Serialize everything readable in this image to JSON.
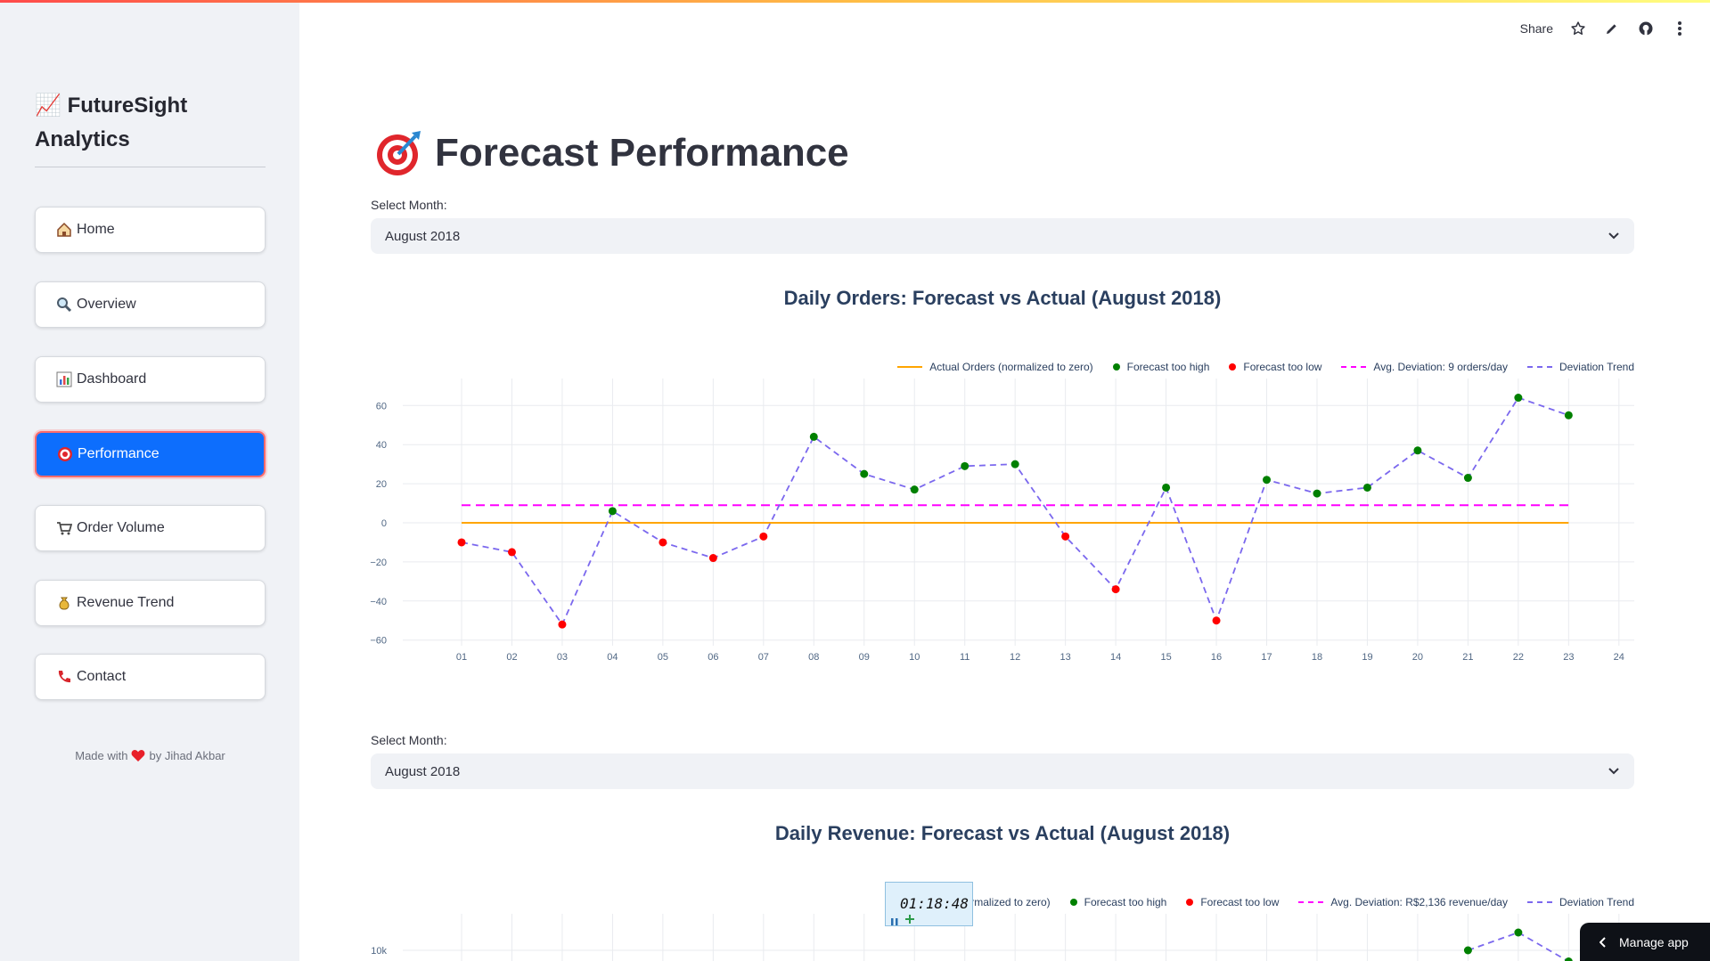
{
  "app": {
    "brand_emoji": "📈",
    "brand": "FutureSight Analytics"
  },
  "header": {
    "share_label": "Share",
    "icons": [
      "star-icon",
      "pencil-icon",
      "github-icon",
      "more-vertical-icon"
    ]
  },
  "sidebar": {
    "items": [
      {
        "label": "Home",
        "icon": "house-icon",
        "emoji": "🏠",
        "active": false
      },
      {
        "label": "Overview",
        "icon": "magnifier-icon",
        "emoji": "🔍",
        "active": false
      },
      {
        "label": "Dashboard",
        "icon": "bar-chart-icon",
        "emoji": "📊",
        "active": false
      },
      {
        "label": "Performance",
        "icon": "target-icon",
        "emoji": "🎯",
        "active": true
      },
      {
        "label": "Order Volume",
        "icon": "cart-icon",
        "emoji": "🛒",
        "active": false
      },
      {
        "label": "Revenue Trend",
        "icon": "money-bag-icon",
        "emoji": "💰",
        "active": false
      },
      {
        "label": "Contact",
        "icon": "phone-icon",
        "emoji": "📞",
        "active": false
      }
    ],
    "footer_pre": "Made with",
    "footer_post": "by Jihad Akbar"
  },
  "page": {
    "title_emoji": "🎯",
    "title": "Forecast Performance"
  },
  "orders_section": {
    "select_label": "Select Month:",
    "select_value": "August 2018",
    "chart_title": "Daily Orders: Forecast vs Actual (August 2018)"
  },
  "revenue_section": {
    "select_label": "Select Month:",
    "select_value": "August 2018",
    "chart_title": "Daily Revenue: Forecast vs Actual (August 2018)"
  },
  "colors": {
    "actual": "#ffa500",
    "too_high": "#008000",
    "too_low": "#ff0000",
    "avg": "#ff00ff",
    "trend": "#7b68ee",
    "active_nav": "#0d6efd"
  },
  "chart_data": [
    {
      "type": "line",
      "title": "Daily Orders: Forecast vs Actual (August 2018)",
      "x": [
        "01",
        "02",
        "03",
        "04",
        "05",
        "06",
        "07",
        "08",
        "09",
        "10",
        "11",
        "12",
        "13",
        "14",
        "15",
        "16",
        "17",
        "18",
        "19",
        "20",
        "21",
        "22",
        "23"
      ],
      "x_ticks": [
        "01",
        "02",
        "03",
        "04",
        "05",
        "06",
        "07",
        "08",
        "09",
        "10",
        "11",
        "12",
        "13",
        "14",
        "15",
        "16",
        "17",
        "18",
        "19",
        "20",
        "21",
        "22",
        "23",
        "24"
      ],
      "ylim": [
        -62,
        68
      ],
      "y_ticks": [
        60,
        40,
        20,
        0,
        -20,
        -40,
        -60
      ],
      "legend": [
        "Actual Orders (normalized to zero)",
        "Forecast too high",
        "Forecast too low",
        "Avg. Deviation: 9 orders/day",
        "Deviation Trend"
      ],
      "legend_position": "top-right",
      "series": [
        {
          "name": "Actual Orders (normalized to zero)",
          "values": [
            0,
            0,
            0,
            0,
            0,
            0,
            0,
            0,
            0,
            0,
            0,
            0,
            0,
            0,
            0,
            0,
            0,
            0,
            0,
            0,
            0,
            0,
            0
          ]
        },
        {
          "name": "Deviation Trend",
          "values": [
            -10,
            -15,
            -52,
            6,
            -10,
            -18,
            -7,
            44,
            25,
            17,
            29,
            30,
            -7,
            -34,
            18,
            -50,
            22,
            15,
            18,
            37,
            23,
            64,
            55
          ]
        },
        {
          "name": "Avg. Deviation: 9 orders/day",
          "values": [
            9,
            9,
            9,
            9,
            9,
            9,
            9,
            9,
            9,
            9,
            9,
            9,
            9,
            9,
            9,
            9,
            9,
            9,
            9,
            9,
            9,
            9,
            9
          ]
        }
      ],
      "grid": true
    },
    {
      "type": "line",
      "title": "Daily Revenue: Forecast vs Actual (August 2018)",
      "legend": [
        "Actual Revenue (normalized to zero)",
        "Forecast too high",
        "Forecast too low",
        "Avg. Deviation: R$2,136 revenue/day",
        "Deviation Trend"
      ],
      "legend_visible_text": [
        "enue (normalized to zero)",
        "Forecast too high",
        "Forecast too low",
        "Avg. Deviation: R$2,136 revenue/day",
        "Deviation Trend"
      ],
      "y_ticks_visible": [
        "10k"
      ],
      "visible_points": [
        {
          "x": "21",
          "y": 10000
        },
        {
          "x": "22",
          "y": 10800
        },
        {
          "x": "23",
          "y": 9500
        }
      ],
      "grid": true
    }
  ],
  "overlay": {
    "timer_text": "01:18:48",
    "manage_app_label": "Manage app"
  }
}
